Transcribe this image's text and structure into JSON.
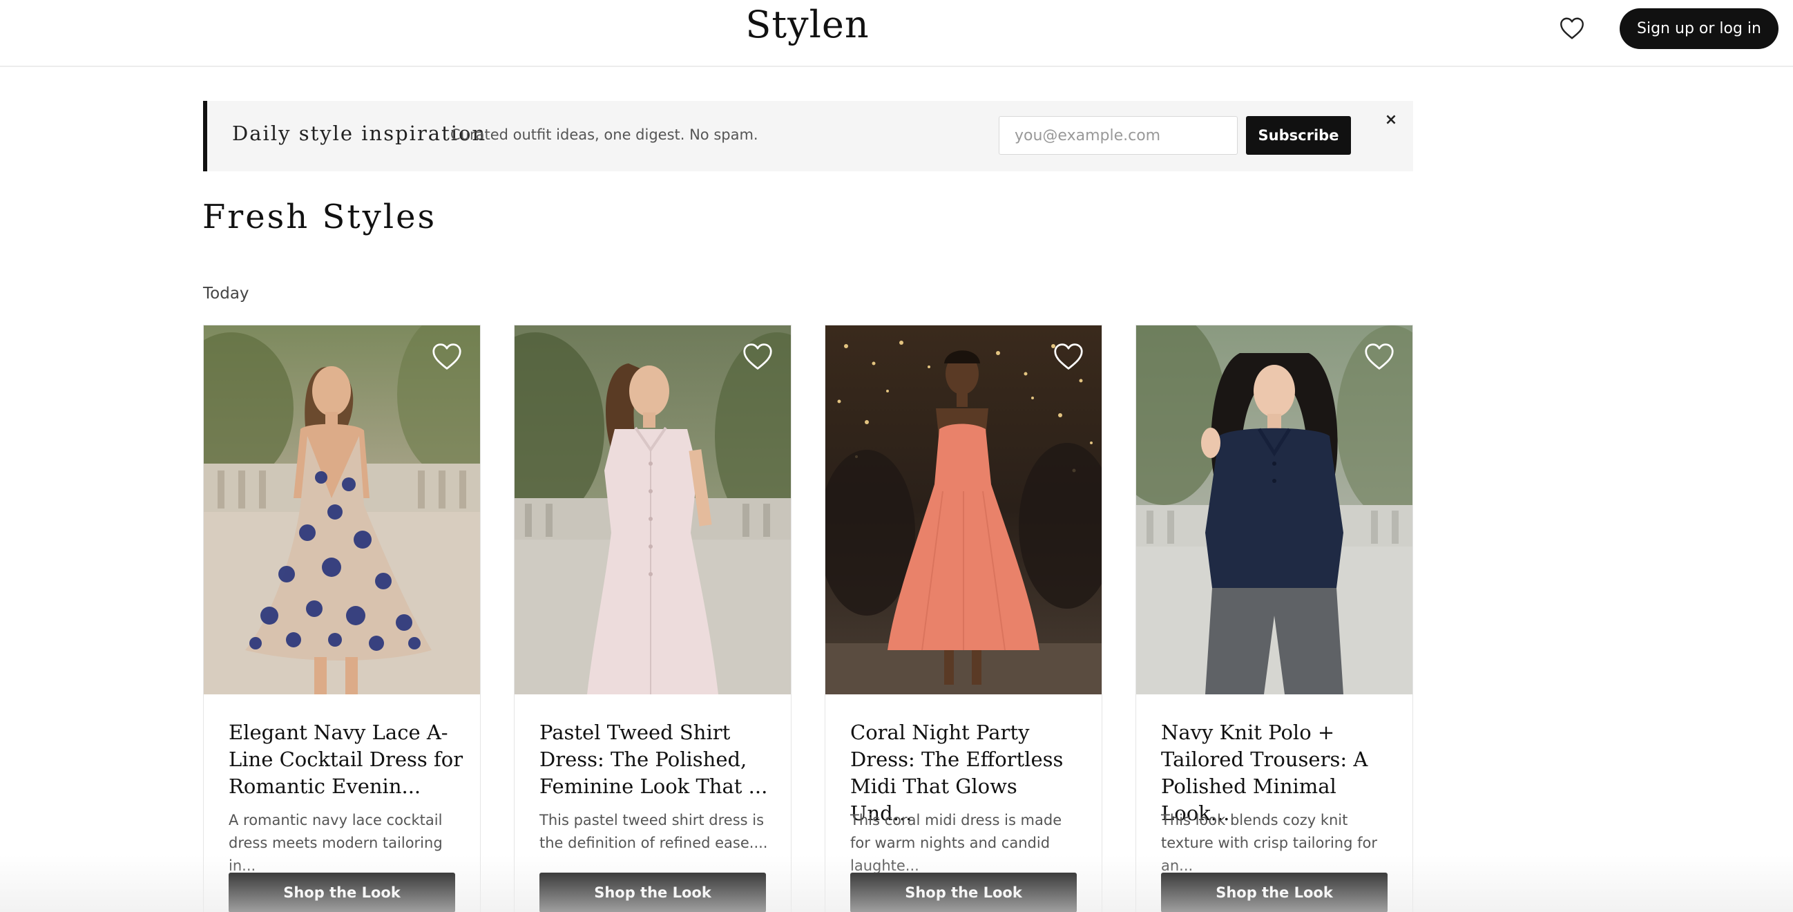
{
  "header": {
    "logo": "Stylen",
    "favorites_icon": "heart-icon",
    "signup_label": "Sign up or log in"
  },
  "newsletter": {
    "title": "Daily style inspiration",
    "subtitle": "Curated outfit ideas, one digest. No spam.",
    "email_placeholder": "you@example.com",
    "subscribe_label": "Subscribe",
    "close_label": "×"
  },
  "section": {
    "title": "Fresh Styles",
    "subheading": "Today"
  },
  "cards": [
    {
      "title": "Elegant Navy Lace A-Line Cocktail Dress for Romantic Evenin...",
      "description": "A romantic navy lace cocktail dress meets modern tailoring in...",
      "button_label": "Shop the Look",
      "favorite_icon": "heart-outline-icon"
    },
    {
      "title": "Pastel Tweed Shirt Dress: The Polished, Feminine Look That ...",
      "description": "This pastel tweed shirt dress is the definition of refined ease....",
      "button_label": "Shop the Look",
      "favorite_icon": "heart-outline-icon"
    },
    {
      "title": "Coral Night Party Dress: The Effortless Midi That Glows Und...",
      "description": "This coral midi dress is made for warm nights and candid laughte...",
      "button_label": "Shop the Look",
      "favorite_icon": "heart-outline-icon"
    },
    {
      "title": "Navy Knit Polo + Tailored Trousers: A Polished Minimal Look...",
      "description": "This look blends cozy knit texture with crisp tailoring for an...",
      "button_label": "Shop the Look",
      "favorite_icon": "heart-outline-icon"
    }
  ],
  "colors": {
    "primary": "#111111",
    "banner_bg": "#f5f5f5",
    "border": "#e5e5e5"
  }
}
